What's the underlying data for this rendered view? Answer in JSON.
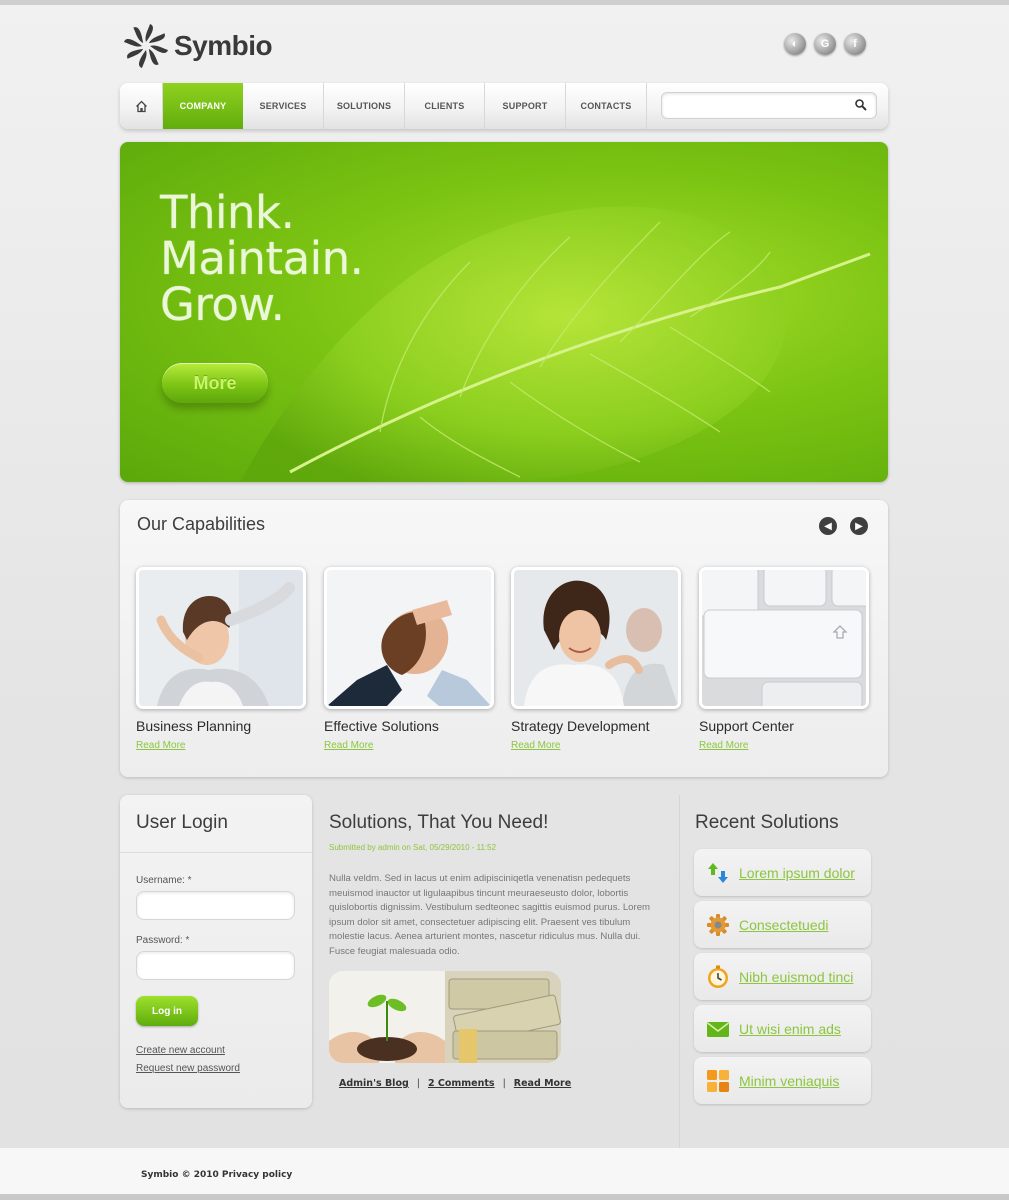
{
  "brand": {
    "name": "Symbio"
  },
  "social": [
    {
      "icon": "rss-icon",
      "glyph": "◐"
    },
    {
      "icon": "google-icon",
      "glyph": "G"
    },
    {
      "icon": "facebook-icon",
      "glyph": "f"
    }
  ],
  "nav": {
    "home_icon": "home-icon",
    "items": [
      {
        "label": "COMPANY",
        "active": true
      },
      {
        "label": "SERVICES",
        "active": false
      },
      {
        "label": "SOLUTIONS",
        "active": false
      },
      {
        "label": "CLIENTS",
        "active": false
      },
      {
        "label": "SUPPORT",
        "active": false
      },
      {
        "label": "CONTACTS",
        "active": false
      }
    ],
    "search": {
      "value": "",
      "placeholder": ""
    }
  },
  "hero": {
    "lines": [
      "Think.",
      "Maintain.",
      "Grow."
    ],
    "button": "More"
  },
  "capabilities": {
    "title": "Our Capabilities",
    "prev_icon": "chevron-left-icon",
    "next_icon": "chevron-right-icon",
    "items": [
      {
        "title": "Business Planning",
        "link": "Read More"
      },
      {
        "title": "Effective Solutions",
        "link": "Read More"
      },
      {
        "title": "Strategy Development",
        "link": "Read More"
      },
      {
        "title": "Support Center",
        "link": "Read More"
      }
    ]
  },
  "login": {
    "title": "User Login",
    "username_label": "Username: *",
    "password_label": "Password: *",
    "username_value": "",
    "password_value": "",
    "button": "Log in",
    "create_account": "Create new account",
    "request_password": "Request new password"
  },
  "solutions": {
    "title": "Solutions, That You Need!",
    "meta": "Submitted by admin on Sat, 05/29/2010 - 11:52",
    "body": "Nulla veldm. Sed in lacus ut enim adipisciniqetla venenatisn pedequets meuismod inauctor ut ligulaapibus tincunt meuraeseusto dolor, lobortis quislobortis dignissim. Vestibulum sedteonec sagittis euismod purus. Lorem ipsum dolor sit amet, consectetuer adipiscing elit. Praesent ves tibulum molestie lacus. Aenea arturient montes, nascetur ridiculus mus. Nulla dui. Fusce feugiat malesuada odio.",
    "links": [
      "Admin's Blog",
      "2 Comments",
      "Read More"
    ]
  },
  "recent": {
    "title": "Recent Solutions",
    "items": [
      {
        "label": "Lorem ipsum dolor",
        "icon": "arrows-icon"
      },
      {
        "label": "Consectetuedi",
        "icon": "gear-icon"
      },
      {
        "label": "Nibh euismod tinci",
        "icon": "clock-icon"
      },
      {
        "label": "Ut wisi enim ads",
        "icon": "mail-icon"
      },
      {
        "label": "Minim veniaquis",
        "icon": "grid-icon"
      }
    ]
  },
  "footer": {
    "text": "Symbio © 2010 Privacy policy"
  },
  "colors": {
    "accent": "#8cc63f",
    "nav_active": "#6fbb10",
    "hero": "#7cc413"
  }
}
